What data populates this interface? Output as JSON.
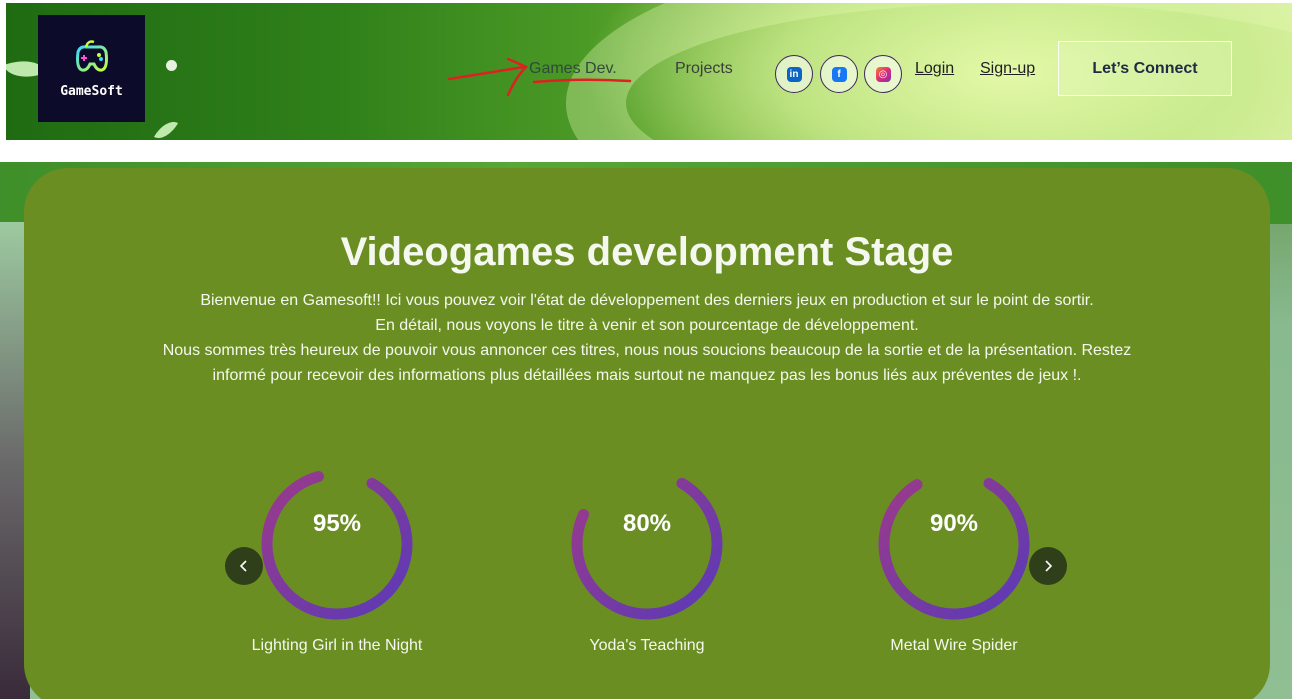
{
  "header": {
    "logo_text": "GameSoft",
    "nav": {
      "games_dev": "Games Dev.",
      "projects": "Projects",
      "login": "Login",
      "signup": "Sign-up"
    },
    "social": [
      {
        "name": "linkedin",
        "glyph": "in",
        "color": "#0a66c2"
      },
      {
        "name": "facebook",
        "glyph": "f",
        "color": "#1877f2"
      },
      {
        "name": "instagram",
        "glyph": "◎",
        "color": "#e1306c"
      }
    ],
    "cta_label": "Let’s Connect"
  },
  "stage": {
    "title": "Videogames development Stage",
    "description": [
      "Bienvenue en Gamesoft!! Ici vous pouvez voir l'état de développement des derniers jeux en production et sur le point de sortir.",
      "En détail, nous voyons le titre à venir et son pourcentage de développement.",
      "Nous sommes très heureux de pouvoir vous annoncer ces titres, nous nous soucions beaucoup de la sortie et de la présentation. Restez",
      "informé pour recevoir des informations plus détaillées mais surtout ne manquez pas les bonus liés aux préventes de jeux !."
    ],
    "games": [
      {
        "label": "Lighting Girl in the Night",
        "percent_text": "95%",
        "progress": 0.95
      },
      {
        "label": "Yoda's Teaching",
        "percent_text": "80%",
        "progress": 0.8
      },
      {
        "label": "Metal Wire Spider",
        "percent_text": "90%",
        "progress": 0.9
      }
    ],
    "prev_icon": "chevron-left-icon",
    "next_icon": "chevron-right-icon"
  },
  "colors": {
    "stage_bg": "#6b8e23",
    "gauge_start": "#9b3a8a",
    "gauge_end": "#5a3ab8",
    "annotation": "#e02020"
  }
}
